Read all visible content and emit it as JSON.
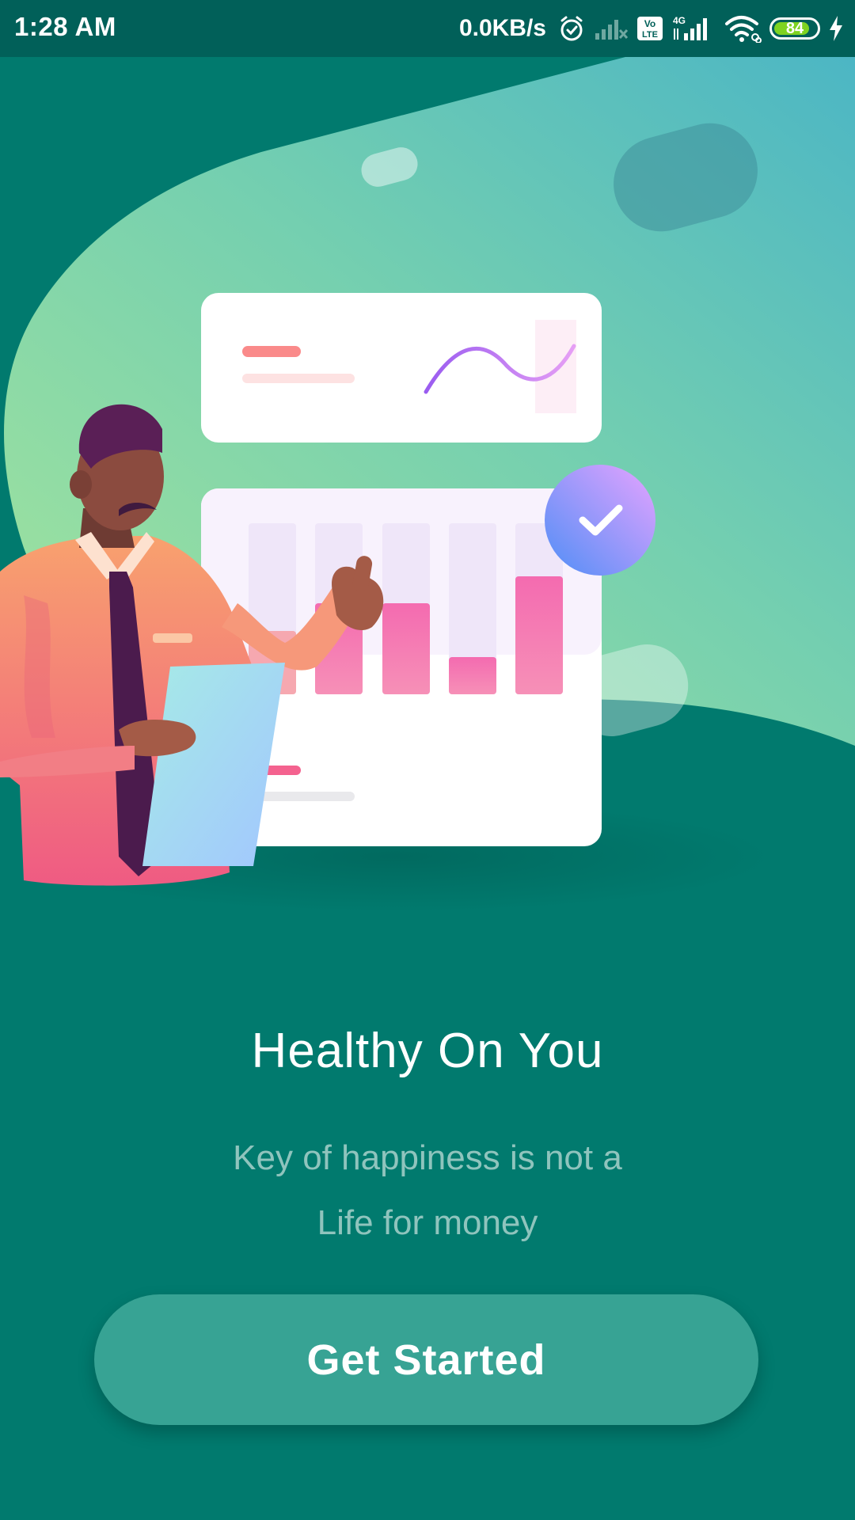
{
  "status_bar": {
    "time": "1:28 AM",
    "network_speed": "0.0KB/s",
    "icons": [
      "alarm-icon",
      "signal-muted-icon",
      "volte-icon",
      "signal-4g-icon",
      "wifi-icon",
      "battery-icon",
      "charging-icon"
    ],
    "volte_label_top": "Vo",
    "volte_label_bottom": "LTE",
    "network_type": "4G",
    "battery_level": "84",
    "battery_fraction": 0.84
  },
  "onboarding": {
    "title": "Healthy On You",
    "subtitle_line_1": "Key of happiness is not a",
    "subtitle_line_2": "Life for money",
    "cta_label": "Get Started"
  },
  "colors": {
    "background": "#017a6e",
    "status_bar": "#016059",
    "button": "#37a394",
    "subtitle": "#8fc4bd",
    "battery": "#7ed321"
  }
}
